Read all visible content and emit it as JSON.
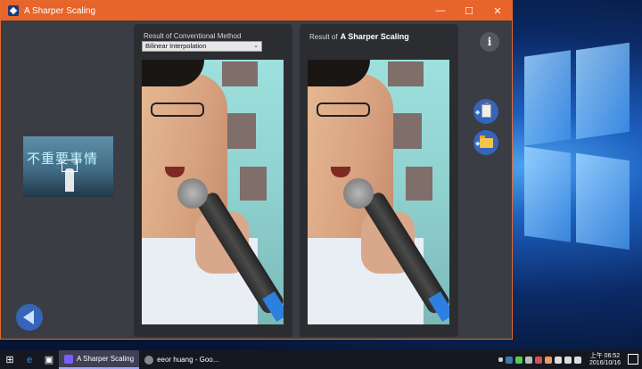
{
  "window": {
    "title": "A Sharper Scaling",
    "controls": {
      "minimize": "—",
      "maximize": "☐",
      "close": "✕"
    }
  },
  "thumbnail": {
    "caption_text": "不重要事情"
  },
  "left_panel": {
    "label": "Result of Conventional Method",
    "method_select": {
      "selected": "Bilinear Interpolation"
    }
  },
  "right_panel": {
    "label_prefix": "Result of",
    "label_bold": "A Sharper Scaling"
  },
  "side_buttons": {
    "info_glyph": "i"
  },
  "taskbar": {
    "apps": [
      {
        "label": "A Sharper Scaling",
        "active": true
      },
      {
        "label": "eeor huang - Goo...",
        "active": false
      }
    ],
    "clock": {
      "time": "上午 06:52",
      "date": "2016/10/16"
    }
  },
  "colors": {
    "titlebar": "#e8642a",
    "window_bg": "#3a3d44",
    "panel_bg": "#2b2d31",
    "accent_button": "#3565b8"
  }
}
